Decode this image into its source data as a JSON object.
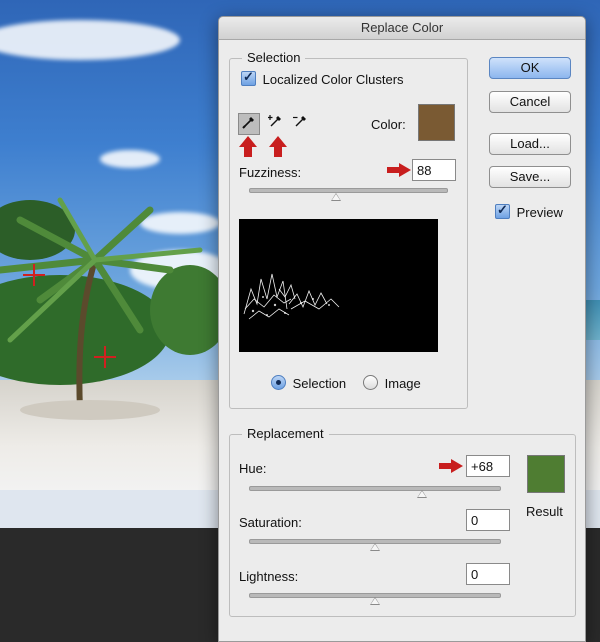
{
  "dialog": {
    "title": "Replace Color"
  },
  "selection": {
    "legend": "Selection",
    "localized_label": "Localized Color Clusters",
    "localized_checked": true,
    "color_label": "Color:",
    "color_swatch": "#7a5a33",
    "fuzziness_label": "Fuzziness:",
    "fuzziness_value": "88",
    "view_selection_label": "Selection",
    "view_image_label": "Image",
    "view_selected": "Selection",
    "tools": [
      "eyedropper-icon",
      "eyedropper-plus-icon",
      "eyedropper-minus-icon"
    ]
  },
  "replacement": {
    "legend": "Replacement",
    "hue_label": "Hue:",
    "hue_value": "+68",
    "saturation_label": "Saturation:",
    "saturation_value": "0",
    "lightness_label": "Lightness:",
    "lightness_value": "0",
    "result_label": "Result",
    "result_swatch": "#4f7d32"
  },
  "buttons": {
    "ok": "OK",
    "cancel": "Cancel",
    "load": "Load...",
    "save": "Save..."
  },
  "preview": {
    "label": "Preview",
    "checked": true
  },
  "colors": {
    "annotation_red": "#c81e1e",
    "default_button_blue": "#8db6ee"
  }
}
